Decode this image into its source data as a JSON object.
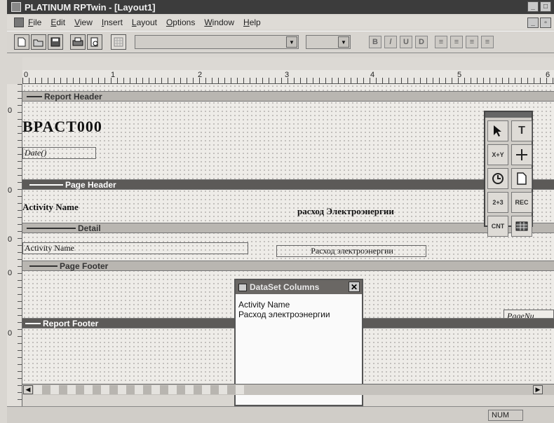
{
  "window": {
    "title": "PLATINUM RPTwin - [Layout1]"
  },
  "menu": [
    "File",
    "Edit",
    "View",
    "Insert",
    "Layout",
    "Options",
    "Window",
    "Help"
  ],
  "toolbar": {
    "bold_label": "B",
    "italic_label": "/",
    "underline_label": "U",
    "underline2_label": "D"
  },
  "ruler": {
    "marks": [
      "0",
      "1",
      "2",
      "3",
      "4",
      "5",
      "6"
    ]
  },
  "gutter": {
    "marks": [
      "0",
      "0",
      "0",
      "0",
      "0"
    ]
  },
  "report": {
    "report_header_label": "Report Header",
    "title": "BPACT000",
    "date_field": "Date()",
    "page_header_label": "Page Header",
    "col1_header": "Activity Name",
    "col2_header": "расход Электроэнергии",
    "detail_label": "Detail",
    "detail_field1": "Activity Name",
    "detail_field2": "Расход электроэнергии",
    "page_footer_label": "Page Footer",
    "page_field": "PageNu",
    "report_footer_label": "Report Footer"
  },
  "palette": {
    "tools": [
      "pointer-icon",
      "text-icon",
      "xy-chart-icon",
      "line-icon",
      "clock-icon",
      "page-icon",
      "number-icon",
      "rec-icon",
      "cnt-icon",
      "grid-icon"
    ],
    "labels": {
      "xy": "X+Y",
      "num": "2+3",
      "rec": "REC",
      "cnt": "CNT"
    }
  },
  "dataset": {
    "title": "DataSet Columns",
    "items": [
      "Activity Name",
      "Расход электроэнергии"
    ]
  },
  "status": {
    "num": "NUM"
  }
}
